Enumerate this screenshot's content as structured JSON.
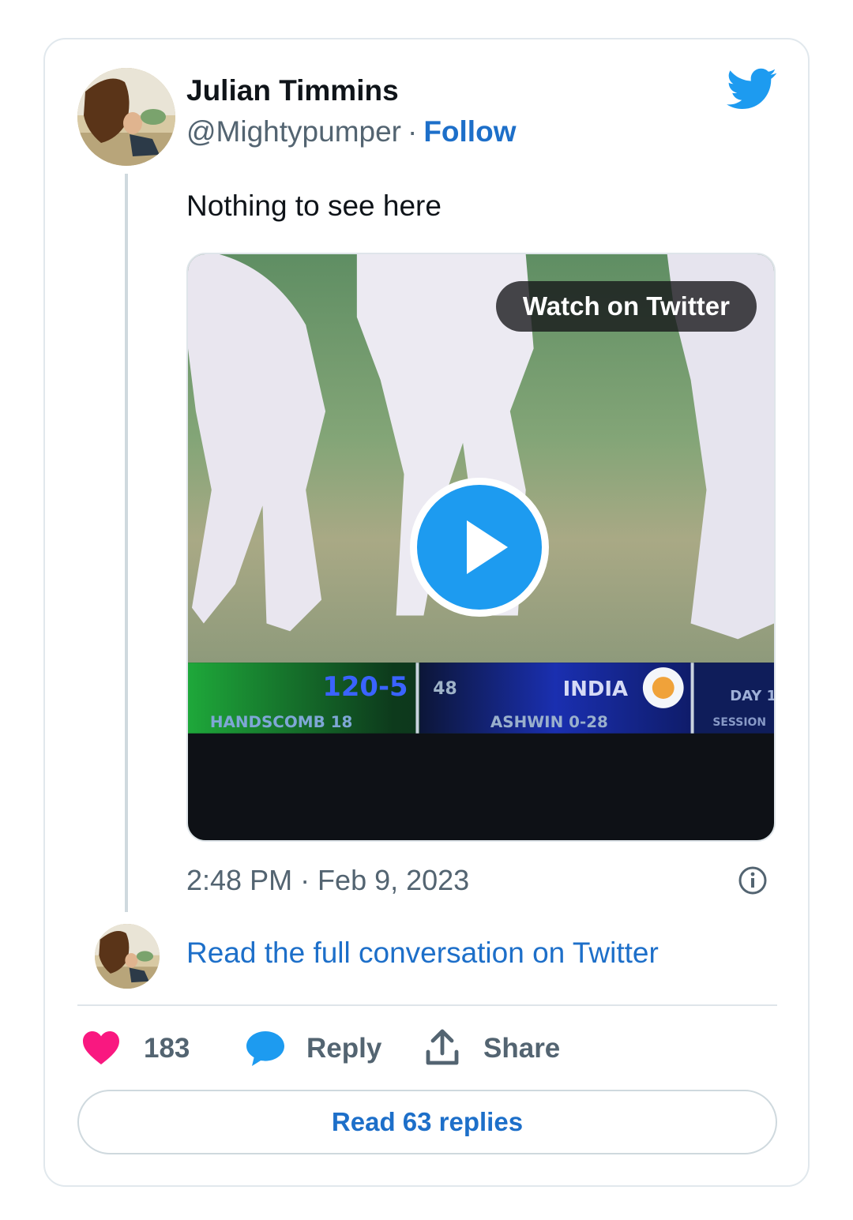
{
  "tweet": {
    "author_name": "Julian Timmins",
    "handle": "@Mightypumper",
    "separator": "·",
    "follow_label": "Follow",
    "text": "Nothing to see here",
    "timestamp": "2:48 PM · Feb 9, 2023"
  },
  "media": {
    "watch_label": "Watch on Twitter",
    "scoreboard": {
      "score": "120-5",
      "overs": "48",
      "batter": "HANDSCOMB 18",
      "team": "INDIA",
      "bowler": "ASHWIN 0-28",
      "extra": "DAY 1",
      "extra2": "SESSION"
    }
  },
  "conversation": {
    "read_full_label": "Read the full conversation on Twitter"
  },
  "actions": {
    "like_count": "183",
    "reply_label": "Reply",
    "share_label": "Share"
  },
  "footer": {
    "read_replies_label": "Read 63 replies"
  },
  "icons": {
    "brand": "twitter-bird-icon",
    "like": "heart-icon",
    "reply": "speech-bubble-icon",
    "share": "share-upload-icon",
    "info": "info-icon",
    "play": "play-icon"
  },
  "colors": {
    "twitter_blue": "#1d9bf0",
    "link_blue": "#1d6fc9",
    "heart_pink": "#f91880",
    "text_dark": "#0f1419",
    "text_gray": "#536471"
  }
}
